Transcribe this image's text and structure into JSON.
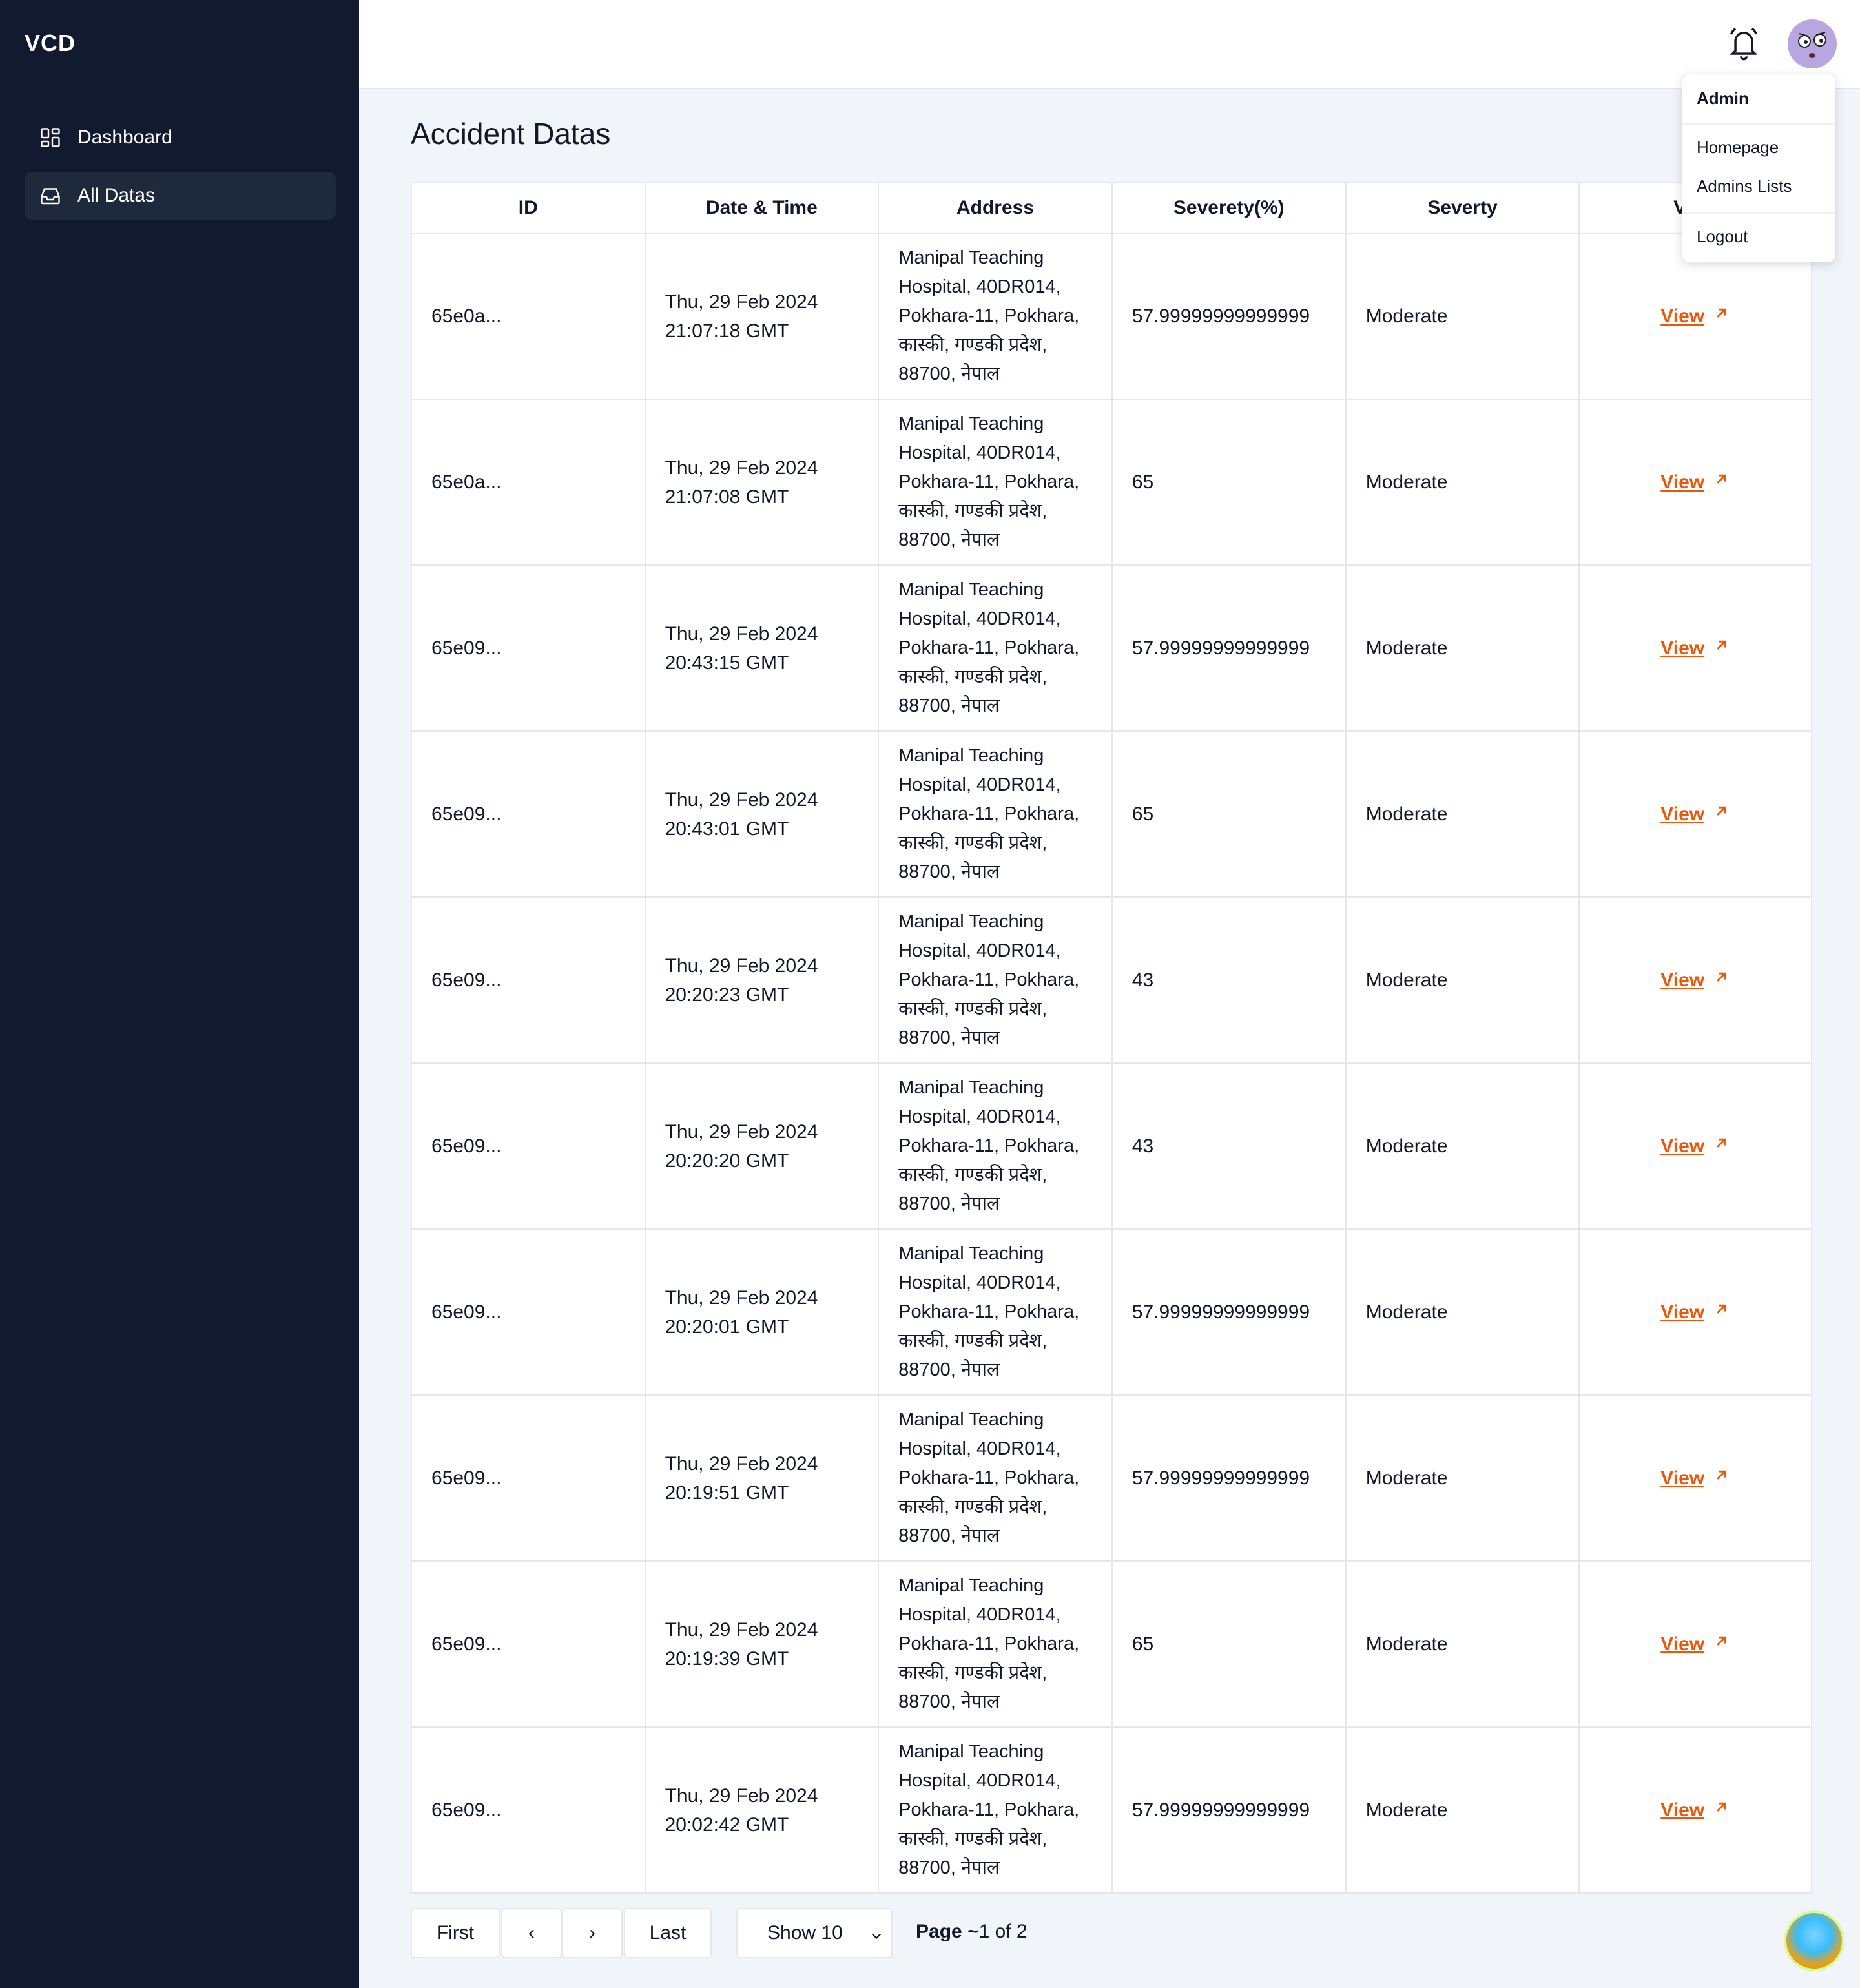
{
  "sidebar": {
    "brand": "VCD",
    "items": [
      {
        "label": "Dashboard",
        "icon": "dashboard-grid-icon"
      },
      {
        "label": "All Datas",
        "icon": "inbox-icon"
      }
    ]
  },
  "header": {
    "bell_icon": "bell-icon",
    "avatar_icon": "avatar"
  },
  "dropdown": {
    "title": "Admin",
    "items": [
      "Homepage",
      "Admins Lists",
      "Logout"
    ]
  },
  "main": {
    "title": "Accident Datas",
    "table": {
      "headers": [
        "ID",
        "Date & Time",
        "Address",
        "Severety(%)",
        "Severty",
        "View"
      ],
      "rows": [
        {
          "id": "65e0a...",
          "date": "Thu, 29 Feb 2024",
          "time": "21:07:18 GMT",
          "address": "Manipal Teaching Hospital, 40DR014, Pokhara-11, Pokhara, कास्की, गण्डकी प्रदेश, 88700, नेपाल",
          "severity_pct": "57.99999999999999",
          "severity": "Moderate",
          "view": "View"
        },
        {
          "id": "65e0a...",
          "date": "Thu, 29 Feb 2024",
          "time": "21:07:08 GMT",
          "address": "Manipal Teaching Hospital, 40DR014, Pokhara-11, Pokhara, कास्की, गण्डकी प्रदेश, 88700, नेपाल",
          "severity_pct": "65",
          "severity": "Moderate",
          "view": "View"
        },
        {
          "id": "65e09...",
          "date": "Thu, 29 Feb 2024",
          "time": "20:43:15 GMT",
          "address": "Manipal Teaching Hospital, 40DR014, Pokhara-11, Pokhara, कास्की, गण्डकी प्रदेश, 88700, नेपाल",
          "severity_pct": "57.99999999999999",
          "severity": "Moderate",
          "view": "View"
        },
        {
          "id": "65e09...",
          "date": "Thu, 29 Feb 2024",
          "time": "20:43:01 GMT",
          "address": "Manipal Teaching Hospital, 40DR014, Pokhara-11, Pokhara, कास्की, गण्डकी प्रदेश, 88700, नेपाल",
          "severity_pct": "65",
          "severity": "Moderate",
          "view": "View"
        },
        {
          "id": "65e09...",
          "date": "Thu, 29 Feb 2024",
          "time": "20:20:23 GMT",
          "address": "Manipal Teaching Hospital, 40DR014, Pokhara-11, Pokhara, कास्की, गण्डकी प्रदेश, 88700, नेपाल",
          "severity_pct": "43",
          "severity": "Moderate",
          "view": "View"
        },
        {
          "id": "65e09...",
          "date": "Thu, 29 Feb 2024",
          "time": "20:20:20 GMT",
          "address": "Manipal Teaching Hospital, 40DR014, Pokhara-11, Pokhara, कास्की, गण्डकी प्रदेश, 88700, नेपाल",
          "severity_pct": "43",
          "severity": "Moderate",
          "view": "View"
        },
        {
          "id": "65e09...",
          "date": "Thu, 29 Feb 2024",
          "time": "20:20:01 GMT",
          "address": "Manipal Teaching Hospital, 40DR014, Pokhara-11, Pokhara, कास्की, गण्डकी प्रदेश, 88700, नेपाल",
          "severity_pct": "57.99999999999999",
          "severity": "Moderate",
          "view": "View"
        },
        {
          "id": "65e09...",
          "date": "Thu, 29 Feb 2024",
          "time": "20:19:51 GMT",
          "address": "Manipal Teaching Hospital, 40DR014, Pokhara-11, Pokhara, कास्की, गण्डकी प्रदेश, 88700, नेपाल",
          "severity_pct": "57.99999999999999",
          "severity": "Moderate",
          "view": "View"
        },
        {
          "id": "65e09...",
          "date": "Thu, 29 Feb 2024",
          "time": "20:19:39 GMT",
          "address": "Manipal Teaching Hospital, 40DR014, Pokhara-11, Pokhara, कास्की, गण्डकी प्रदेश, 88700, नेपाल",
          "severity_pct": "65",
          "severity": "Moderate",
          "view": "View"
        },
        {
          "id": "65e09...",
          "date": "Thu, 29 Feb 2024",
          "time": "20:02:42 GMT",
          "address": "Manipal Teaching Hospital, 40DR014, Pokhara-11, Pokhara, कास्की, गण्डकी प्रदेश, 88700, नेपाल",
          "severity_pct": "57.99999999999999",
          "severity": "Moderate",
          "view": "View"
        }
      ]
    }
  },
  "pagination": {
    "first": "First",
    "prev": "‹",
    "next": "›",
    "last": "Last",
    "show": "Show 10",
    "page_label": "Page ~",
    "page_value": "1 of 2"
  },
  "colors": {
    "sidebar_bg": "#111a2e",
    "link": "#ea580c",
    "page_bg": "#f1f5f9"
  }
}
